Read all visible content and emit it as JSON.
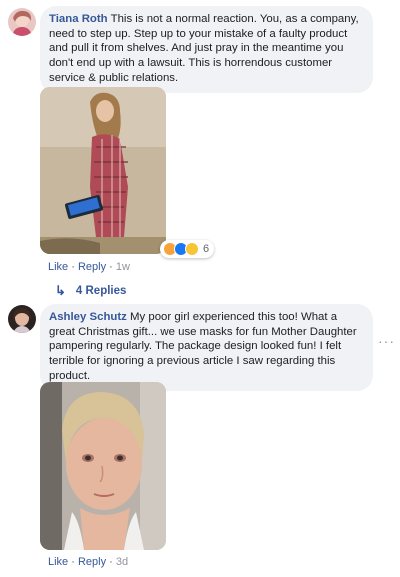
{
  "comment1": {
    "author": "Tiana Roth",
    "text": "This is not a normal reaction. You, as a company, need to step up. Step up to your mistake of a faulty product and pull it from shelves. And just pray in the meantime you don't end up with a lawsuit. This is horrendous customer service & public relations.",
    "reaction_count": "6",
    "reaction_icons": [
      "angry-icon",
      "like-icon",
      "wow-icon"
    ],
    "actions": {
      "like": "Like",
      "sep1": " · ",
      "reply": "Reply",
      "sep2": " · ",
      "time": "1w"
    },
    "replies": {
      "arrow": "↳",
      "label": "4 Replies"
    }
  },
  "comment2": {
    "author": "Ashley Schutz",
    "text": "My poor girl experienced this too! What a great Christmas gift... we use masks for fun Mother Daughter pampering regularly. The package design looked fun! I felt terrible for ignoring a previous article I saw regarding this product.",
    "more_label": "···",
    "actions": {
      "like": "Like",
      "sep1": " · ",
      "reply": "Reply",
      "sep2": " · ",
      "time": "3d"
    }
  },
  "colors": {
    "link": "#365899",
    "bubble": "#f0f2f5",
    "meta": "#90949c"
  }
}
